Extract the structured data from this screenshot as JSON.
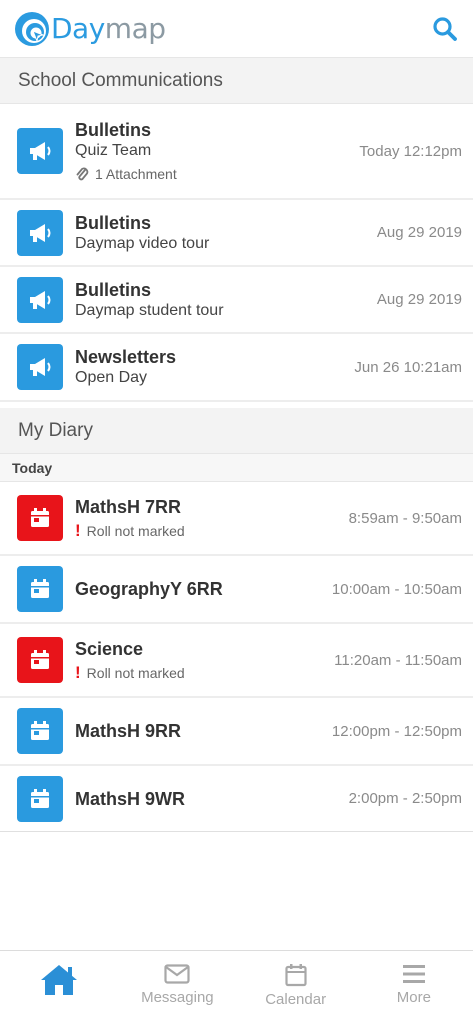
{
  "header": {
    "logo_text_day": "Day",
    "logo_text_rest": "map"
  },
  "communications": {
    "section_title": "School Communications",
    "items": [
      {
        "title": "Bulletins",
        "subtitle": "Quiz Team",
        "attachment": "1 Attachment",
        "time": "Today 12:12pm"
      },
      {
        "title": "Bulletins",
        "subtitle": "Daymap video tour",
        "time": "Aug 29 2019"
      },
      {
        "title": "Bulletins",
        "subtitle": "Daymap student tour",
        "time": "Aug 29 2019"
      },
      {
        "title": "Newsletters",
        "subtitle": "Open Day",
        "time": "Jun 26 10:21am"
      }
    ]
  },
  "diary": {
    "section_title": "My Diary",
    "group_label": "Today",
    "items": [
      {
        "title": "MathsH 7RR",
        "warning": "Roll not marked",
        "time": "8:59am - 9:50am",
        "status": "red"
      },
      {
        "title": "GeographyY 6RR",
        "time": "10:00am - 10:50am",
        "status": "blue"
      },
      {
        "title": "Science",
        "warning": "Roll not marked",
        "time": "11:20am - 11:50am",
        "status": "red"
      },
      {
        "title": "MathsH 9RR",
        "time": "12:00pm - 12:50pm",
        "status": "blue"
      },
      {
        "title": "MathsH 9WR",
        "time": "2:00pm - 2:50pm",
        "status": "blue"
      }
    ]
  },
  "tabbar": {
    "home_icon": "home-icon",
    "messaging_label": "Messaging",
    "calendar_label": "Calendar",
    "more_label": "More"
  },
  "colors": {
    "brand_blue": "#2a9adf",
    "alert_red": "#e8141a",
    "active_tab": "#2b8fd6",
    "inactive_tab": "#a8a8a8"
  }
}
